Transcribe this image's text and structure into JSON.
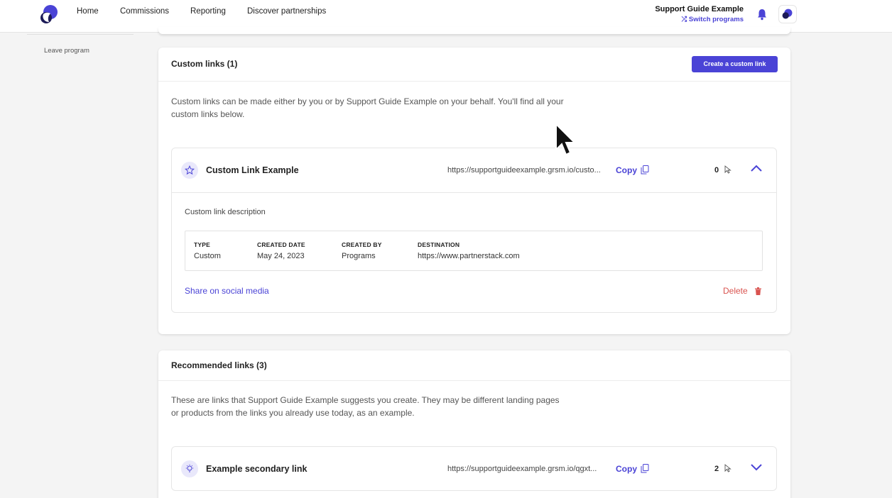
{
  "nav": {
    "home": "Home",
    "commissions": "Commissions",
    "reporting": "Reporting",
    "discover": "Discover partnerships",
    "company_name": "Support Guide Example",
    "switch_label": "Switch programs"
  },
  "sidebar": {
    "leave_label": "Leave program"
  },
  "custom_links": {
    "title": "Custom links (1)",
    "create_button": "Create a custom link",
    "description": "Custom links can be made either by you or by Support Guide Example on your behalf. You'll find all your custom links below.",
    "link": {
      "name": "Custom Link Example",
      "url": "https://supportguideexample.grsm.io/custo...",
      "copy_label": "Copy",
      "clicks": "0",
      "description": "Custom link description",
      "meta": {
        "type_label": "TYPE",
        "type_value": "Custom",
        "created_date_label": "CREATED DATE",
        "created_date_value": "May 24, 2023",
        "created_by_label": "CREATED BY",
        "created_by_value": "Programs",
        "destination_label": "DESTINATION",
        "destination_value": "https://www.partnerstack.com"
      },
      "share_label": "Share on social media",
      "delete_label": "Delete"
    }
  },
  "recommended_links": {
    "title": "Recommended links (3)",
    "description": "These are links that Support Guide Example suggests you create. They may be different landing pages or products from the links you already use today, as an example.",
    "link": {
      "name": "Example secondary link",
      "url": "https://supportguideexample.grsm.io/qgxt...",
      "copy_label": "Copy",
      "clicks": "2"
    }
  },
  "colors": {
    "accent": "#4a43d6",
    "delete": "#d9534f",
    "background": "#f4f4f4"
  }
}
